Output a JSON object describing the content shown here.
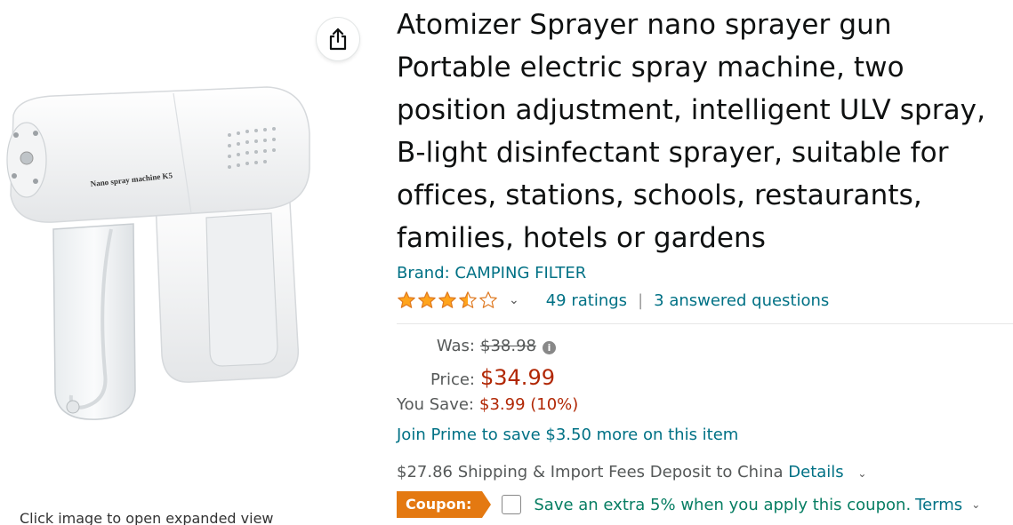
{
  "image": {
    "caption": "Click image to open expanded view",
    "device_label": "Nano spray machine K5",
    "share_icon": "share-icon"
  },
  "product": {
    "title": "Atomizer Sprayer nano sprayer gun Portable electric spray machine, two position adjustment, intelligent ULV spray, B-light disinfectant sprayer, suitable for offices, stations, schools, restaurants, families, hotels or gardens",
    "brand": "Brand: CAMPING FILTER",
    "rating": 3.5,
    "rating_max": 5,
    "ratings_count": "49 ratings",
    "separator": "|",
    "answered_questions": "3 answered questions"
  },
  "price": {
    "was_label": "Was:",
    "was_value": "$38.98",
    "price_label": "Price:",
    "price_value": "$34.99",
    "save_label": "You Save:",
    "save_value": "$3.99 (10%)",
    "prime_text": "Join Prime to save $3.50 more on this item",
    "info_icon": "info-icon"
  },
  "shipping": {
    "text": "$27.86 Shipping & Import Fees Deposit to China",
    "details_link": "Details"
  },
  "coupon": {
    "badge": "Coupon:",
    "text": "Save an extra 5% when you apply this coupon.",
    "terms": "Terms"
  },
  "colors": {
    "link": "#007185",
    "price": "#b12704",
    "star": "#ffa41c",
    "coupon_badge": "#e47911",
    "coupon_text": "#067d62"
  }
}
